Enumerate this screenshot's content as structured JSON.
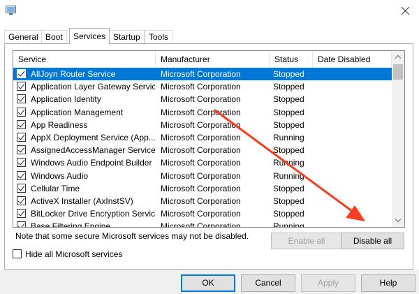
{
  "window": {
    "icon": "system-configuration-icon",
    "close_icon": "close-icon"
  },
  "tabs": [
    {
      "label": "General"
    },
    {
      "label": "Boot"
    },
    {
      "label": "Services",
      "active": true
    },
    {
      "label": "Startup"
    },
    {
      "label": "Tools"
    }
  ],
  "list": {
    "columns": [
      "Service",
      "Manufacturer",
      "Status",
      "Date Disabled"
    ],
    "rows": [
      {
        "service": "AllJoyn Router Service",
        "manufacturer": "Microsoft Corporation",
        "status": "Stopped",
        "checked": true,
        "selected": true
      },
      {
        "service": "Application Layer Gateway Service",
        "manufacturer": "Microsoft Corporation",
        "status": "Stopped",
        "checked": true
      },
      {
        "service": "Application Identity",
        "manufacturer": "Microsoft Corporation",
        "status": "Stopped",
        "checked": true
      },
      {
        "service": "Application Management",
        "manufacturer": "Microsoft Corporation",
        "status": "Stopped",
        "checked": true
      },
      {
        "service": "App Readiness",
        "manufacturer": "Microsoft Corporation",
        "status": "Stopped",
        "checked": true
      },
      {
        "service": "AppX Deployment Service (App...",
        "manufacturer": "Microsoft Corporation",
        "status": "Running",
        "checked": true
      },
      {
        "service": "AssignedAccessManager Service",
        "manufacturer": "Microsoft Corporation",
        "status": "Stopped",
        "checked": true
      },
      {
        "service": "Windows Audio Endpoint Builder",
        "manufacturer": "Microsoft Corporation",
        "status": "Running",
        "checked": true
      },
      {
        "service": "Windows Audio",
        "manufacturer": "Microsoft Corporation",
        "status": "Running",
        "checked": true
      },
      {
        "service": "Cellular Time",
        "manufacturer": "Microsoft Corporation",
        "status": "Stopped",
        "checked": true
      },
      {
        "service": "ActiveX Installer (AxInstSV)",
        "manufacturer": "Microsoft Corporation",
        "status": "Stopped",
        "checked": true
      },
      {
        "service": "BitLocker Drive Encryption Service",
        "manufacturer": "Microsoft Corporation",
        "status": "Stopped",
        "checked": true
      },
      {
        "service": "Base Filtering Engine",
        "manufacturer": "Microsoft Corporation",
        "status": "Running",
        "checked": true
      }
    ]
  },
  "note": "Note that some secure Microsoft services may not be disabled.",
  "buttons": {
    "enable_all": "Enable all",
    "disable_all": "Disable all",
    "ok": "OK",
    "cancel": "Cancel",
    "apply": "Apply",
    "help": "Help"
  },
  "hide_ms_label": "Hide all Microsoft services",
  "colors": {
    "selection": "#0078d7",
    "arrow": "#ff3b1f"
  }
}
